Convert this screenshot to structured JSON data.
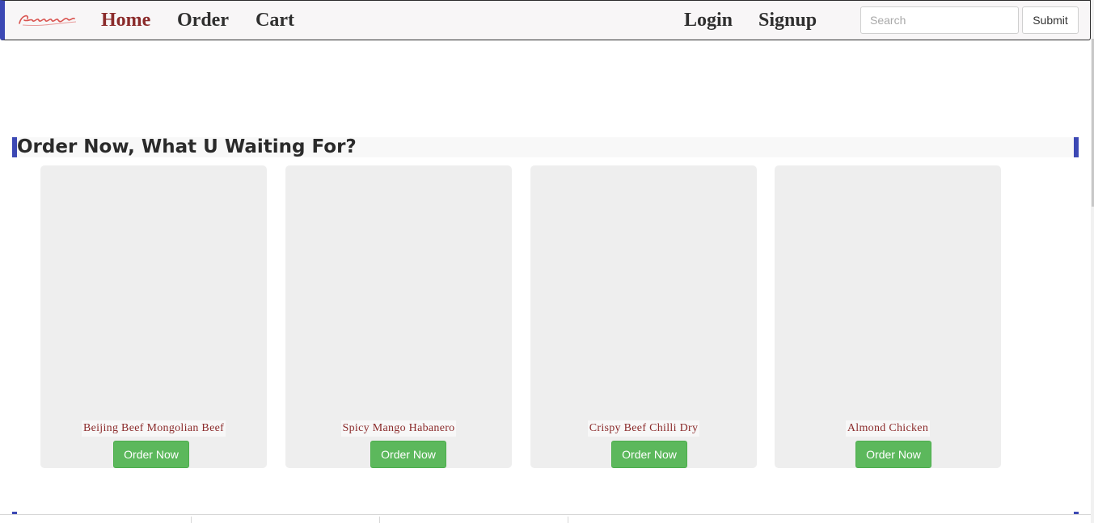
{
  "nav": {
    "brand_alt": "Gourmet",
    "links": [
      "Home",
      "Order",
      "Cart"
    ],
    "auth_links": [
      "Login",
      "Signup"
    ],
    "search_placeholder": "Search",
    "submit_label": "Submit"
  },
  "section": {
    "heading": "Order Now, What U Waiting For?"
  },
  "items": [
    {
      "name": "Beijing Beef Mongolian Beef",
      "button": "Order Now"
    },
    {
      "name": "Spicy Mango Habanero",
      "button": "Order Now"
    },
    {
      "name": "Crispy Beef Chilli Dry",
      "button": "Order Now"
    },
    {
      "name": "Almond Chicken",
      "button": "Order Now"
    }
  ],
  "colors": {
    "accent": "#3c48b4",
    "active_link": "#8b2b2b",
    "button_green": "#5cb85c"
  }
}
